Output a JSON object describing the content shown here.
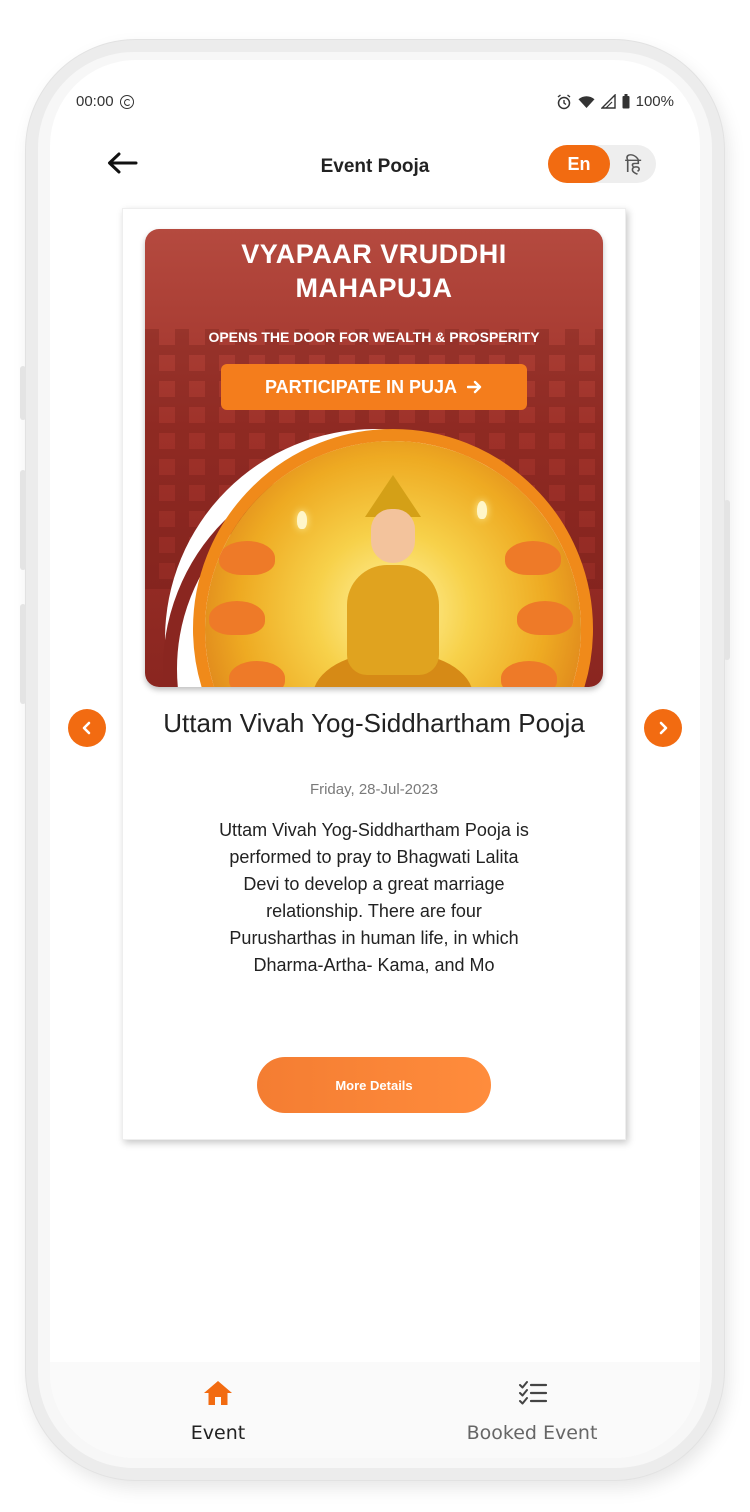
{
  "status_bar": {
    "time": "00:00",
    "battery": "100%"
  },
  "header": {
    "title": "Event Pooja",
    "lang_en": "En",
    "lang_hi": "हि"
  },
  "banner": {
    "title_line1": "VYAPAAR VRUDDHI",
    "title_line2": "MAHAPUJA",
    "subtitle": "OPENS THE DOOR FOR WEALTH & PROSPERITY",
    "cta": "PARTICIPATE IN PUJA"
  },
  "event": {
    "title": "Uttam Vivah Yog-Siddhartham Pooja",
    "date": "Friday, 28-Jul-2023",
    "description": "Uttam Vivah Yog-Siddhartham Pooja is performed to pray to Bhagwati Lalita Devi to develop a great marriage relationship. There are four Purusharthas in human life, in which Dharma-Artha- Kama, and Mo",
    "more_details": "More Details"
  },
  "bottom_nav": {
    "items": [
      {
        "label": "Event",
        "icon": "home-icon",
        "active": true
      },
      {
        "label": "Booked Event",
        "icon": "checklist-icon",
        "active": false
      }
    ]
  },
  "colors": {
    "accent": "#f26b11",
    "banner_bg": "#9e3129",
    "cta": "#f47d1c"
  }
}
